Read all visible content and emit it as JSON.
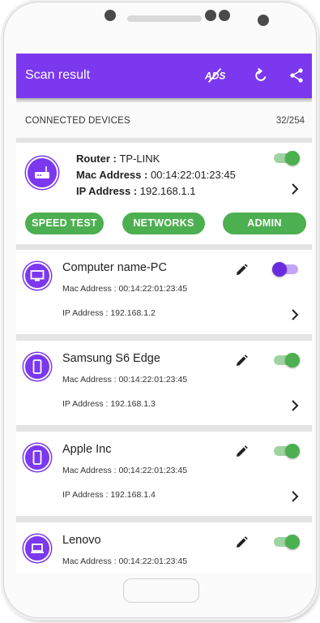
{
  "appbar": {
    "title": "Scan result",
    "icons": [
      "ads-off-icon",
      "refresh-icon",
      "share-icon"
    ]
  },
  "section": {
    "title": "CONNECTED DEVICES",
    "count": "32/254"
  },
  "router": {
    "icon": "router-icon",
    "router_label": "Router : ",
    "router_value": "TP-LINK",
    "mac_label": "Mac Address : ",
    "mac_value": "00:14:22:01:23:45",
    "ip_label": "IP Address : ",
    "ip_value": "192.168.1.1",
    "toggle_on": true,
    "buttons": {
      "speed_test": "SPEED TEST",
      "networks": "NETWORKS",
      "admin": "ADMIN"
    }
  },
  "devices": [
    {
      "name": "Computer name-PC",
      "mac": "Mac Address : 00:14:22:01:23:45",
      "ip": "IP Address : 192.168.1.2",
      "icon": "monitor-icon",
      "toggle": "purple"
    },
    {
      "name": "Samsung S6 Edge",
      "mac": "Mac Address : 00:14:22:01:23:45",
      "ip": "IP Address : 192.168.1.3",
      "icon": "phone-icon",
      "toggle": "green"
    },
    {
      "name": "Apple Inc",
      "mac": "Mac Address : 00:14:22:01:23:45",
      "ip": "IP Address : 192.168.1.4",
      "icon": "phone-icon",
      "toggle": "green"
    },
    {
      "name": "Lenovo",
      "mac": "Mac Address : 00:14:22:01:23:45",
      "ip": "",
      "icon": "laptop-icon",
      "toggle": "green"
    }
  ],
  "colors": {
    "primary": "#7b38ee",
    "accent_green": "#4caf50",
    "background": "#e4e4e4"
  }
}
